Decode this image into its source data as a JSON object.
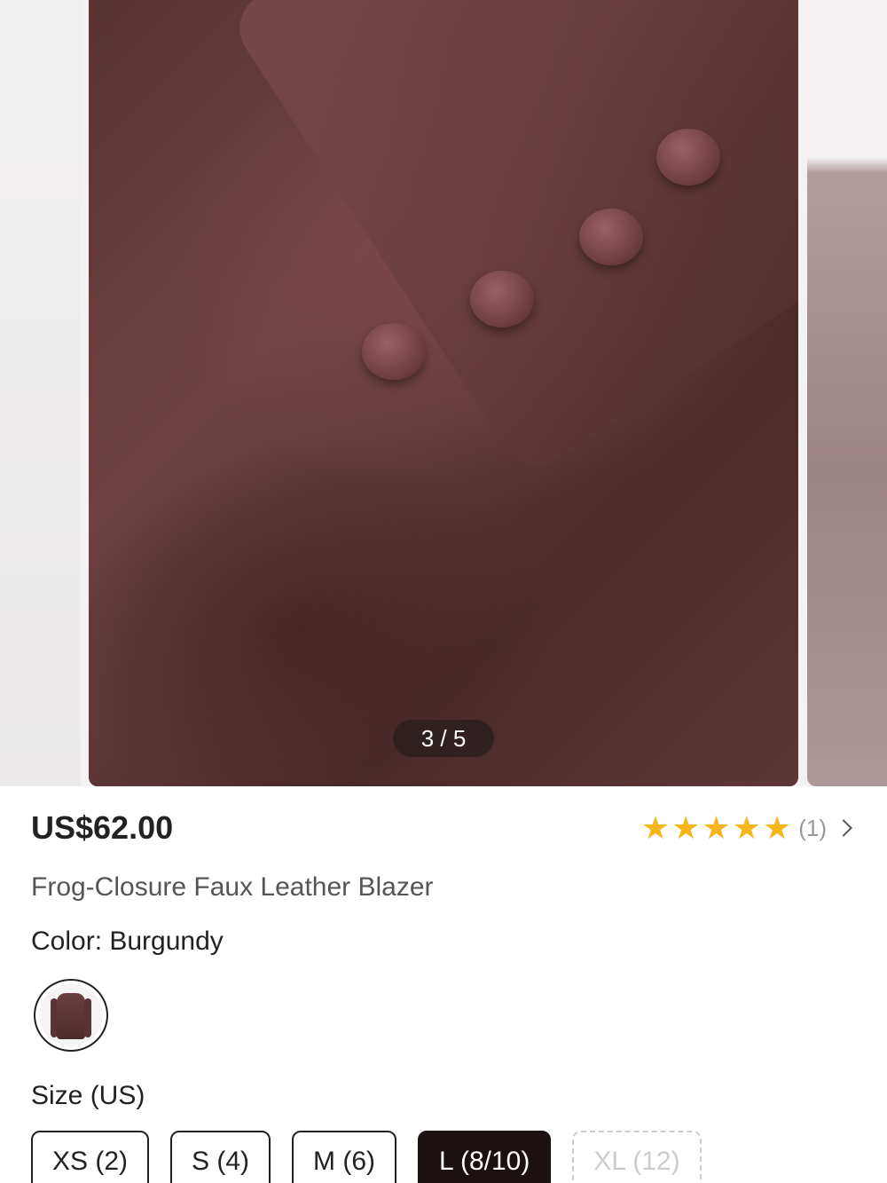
{
  "gallery": {
    "current": "3 / 5"
  },
  "product": {
    "price": "US$62.00",
    "title": "Frog-Closure Faux Leather Blazer",
    "rating_count": "(1)",
    "rating_stars": 5,
    "color_label": "Color: Burgundy",
    "size_label": "Size (US)",
    "sizes": [
      "XS (2)",
      "S (4)",
      "M (6)",
      "L (8/10)",
      "XL (12)"
    ],
    "selected_size": "L (8/10)",
    "unavailable_size": "XL (12)"
  },
  "colors": {
    "star": "#f8b51a",
    "selected_bg": "#1b1111"
  }
}
